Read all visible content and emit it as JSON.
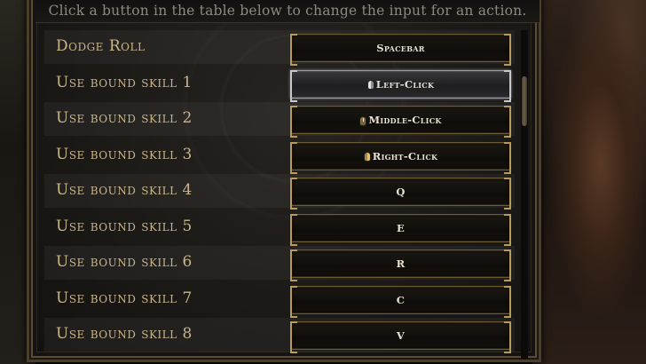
{
  "instruction": "Click a button in the table below to change the input for an action.",
  "rows": [
    {
      "action": "Dodge Roll",
      "key": "Spacebar",
      "icon": null,
      "selected": false,
      "alt": true
    },
    {
      "action": "Use bound skill 1",
      "key": "Left-Click",
      "icon": "mouse-left-icon",
      "selected": true,
      "alt": false
    },
    {
      "action": "Use bound skill 2",
      "key": "Middle-Click",
      "icon": "mouse-middle-icon",
      "selected": false,
      "alt": true
    },
    {
      "action": "Use bound skill 3",
      "key": "Right-Click",
      "icon": "mouse-right-icon",
      "selected": false,
      "alt": false
    },
    {
      "action": "Use bound skill 4",
      "key": "Q",
      "icon": null,
      "selected": false,
      "alt": true
    },
    {
      "action": "Use bound skill 5",
      "key": "E",
      "icon": null,
      "selected": false,
      "alt": false
    },
    {
      "action": "Use bound skill 6",
      "key": "R",
      "icon": null,
      "selected": false,
      "alt": true
    },
    {
      "action": "Use bound skill 7",
      "key": "C",
      "icon": null,
      "selected": false,
      "alt": false
    },
    {
      "action": "Use bound skill 8",
      "key": "V",
      "icon": null,
      "selected": false,
      "alt": true
    }
  ],
  "colors": {
    "label": "#c9b58a",
    "accent_gold": "#b89a5a",
    "key_text": "#e8e2d2",
    "instruction": "#8c8a7e"
  }
}
